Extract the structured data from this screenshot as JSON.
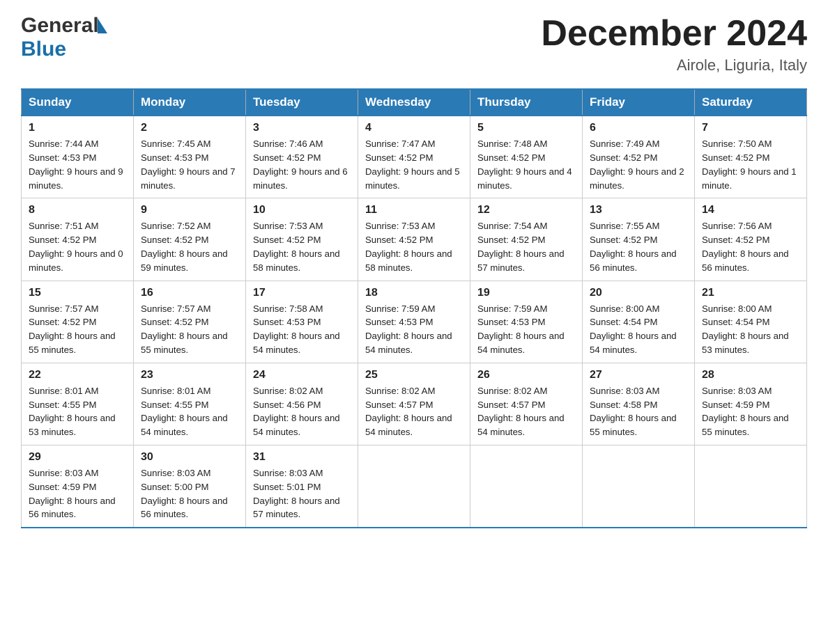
{
  "header": {
    "logo_general": "General",
    "logo_blue": "Blue",
    "month_title": "December 2024",
    "location": "Airole, Liguria, Italy"
  },
  "days_of_week": [
    "Sunday",
    "Monday",
    "Tuesday",
    "Wednesday",
    "Thursday",
    "Friday",
    "Saturday"
  ],
  "weeks": [
    [
      {
        "day": "1",
        "sunrise": "7:44 AM",
        "sunset": "4:53 PM",
        "daylight": "9 hours and 9 minutes."
      },
      {
        "day": "2",
        "sunrise": "7:45 AM",
        "sunset": "4:53 PM",
        "daylight": "9 hours and 7 minutes."
      },
      {
        "day": "3",
        "sunrise": "7:46 AM",
        "sunset": "4:52 PM",
        "daylight": "9 hours and 6 minutes."
      },
      {
        "day": "4",
        "sunrise": "7:47 AM",
        "sunset": "4:52 PM",
        "daylight": "9 hours and 5 minutes."
      },
      {
        "day": "5",
        "sunrise": "7:48 AM",
        "sunset": "4:52 PM",
        "daylight": "9 hours and 4 minutes."
      },
      {
        "day": "6",
        "sunrise": "7:49 AM",
        "sunset": "4:52 PM",
        "daylight": "9 hours and 2 minutes."
      },
      {
        "day": "7",
        "sunrise": "7:50 AM",
        "sunset": "4:52 PM",
        "daylight": "9 hours and 1 minute."
      }
    ],
    [
      {
        "day": "8",
        "sunrise": "7:51 AM",
        "sunset": "4:52 PM",
        "daylight": "9 hours and 0 minutes."
      },
      {
        "day": "9",
        "sunrise": "7:52 AM",
        "sunset": "4:52 PM",
        "daylight": "8 hours and 59 minutes."
      },
      {
        "day": "10",
        "sunrise": "7:53 AM",
        "sunset": "4:52 PM",
        "daylight": "8 hours and 58 minutes."
      },
      {
        "day": "11",
        "sunrise": "7:53 AM",
        "sunset": "4:52 PM",
        "daylight": "8 hours and 58 minutes."
      },
      {
        "day": "12",
        "sunrise": "7:54 AM",
        "sunset": "4:52 PM",
        "daylight": "8 hours and 57 minutes."
      },
      {
        "day": "13",
        "sunrise": "7:55 AM",
        "sunset": "4:52 PM",
        "daylight": "8 hours and 56 minutes."
      },
      {
        "day": "14",
        "sunrise": "7:56 AM",
        "sunset": "4:52 PM",
        "daylight": "8 hours and 56 minutes."
      }
    ],
    [
      {
        "day": "15",
        "sunrise": "7:57 AM",
        "sunset": "4:52 PM",
        "daylight": "8 hours and 55 minutes."
      },
      {
        "day": "16",
        "sunrise": "7:57 AM",
        "sunset": "4:52 PM",
        "daylight": "8 hours and 55 minutes."
      },
      {
        "day": "17",
        "sunrise": "7:58 AM",
        "sunset": "4:53 PM",
        "daylight": "8 hours and 54 minutes."
      },
      {
        "day": "18",
        "sunrise": "7:59 AM",
        "sunset": "4:53 PM",
        "daylight": "8 hours and 54 minutes."
      },
      {
        "day": "19",
        "sunrise": "7:59 AM",
        "sunset": "4:53 PM",
        "daylight": "8 hours and 54 minutes."
      },
      {
        "day": "20",
        "sunrise": "8:00 AM",
        "sunset": "4:54 PM",
        "daylight": "8 hours and 54 minutes."
      },
      {
        "day": "21",
        "sunrise": "8:00 AM",
        "sunset": "4:54 PM",
        "daylight": "8 hours and 53 minutes."
      }
    ],
    [
      {
        "day": "22",
        "sunrise": "8:01 AM",
        "sunset": "4:55 PM",
        "daylight": "8 hours and 53 minutes."
      },
      {
        "day": "23",
        "sunrise": "8:01 AM",
        "sunset": "4:55 PM",
        "daylight": "8 hours and 54 minutes."
      },
      {
        "day": "24",
        "sunrise": "8:02 AM",
        "sunset": "4:56 PM",
        "daylight": "8 hours and 54 minutes."
      },
      {
        "day": "25",
        "sunrise": "8:02 AM",
        "sunset": "4:57 PM",
        "daylight": "8 hours and 54 minutes."
      },
      {
        "day": "26",
        "sunrise": "8:02 AM",
        "sunset": "4:57 PM",
        "daylight": "8 hours and 54 minutes."
      },
      {
        "day": "27",
        "sunrise": "8:03 AM",
        "sunset": "4:58 PM",
        "daylight": "8 hours and 55 minutes."
      },
      {
        "day": "28",
        "sunrise": "8:03 AM",
        "sunset": "4:59 PM",
        "daylight": "8 hours and 55 minutes."
      }
    ],
    [
      {
        "day": "29",
        "sunrise": "8:03 AM",
        "sunset": "4:59 PM",
        "daylight": "8 hours and 56 minutes."
      },
      {
        "day": "30",
        "sunrise": "8:03 AM",
        "sunset": "5:00 PM",
        "daylight": "8 hours and 56 minutes."
      },
      {
        "day": "31",
        "sunrise": "8:03 AM",
        "sunset": "5:01 PM",
        "daylight": "8 hours and 57 minutes."
      },
      null,
      null,
      null,
      null
    ]
  ]
}
